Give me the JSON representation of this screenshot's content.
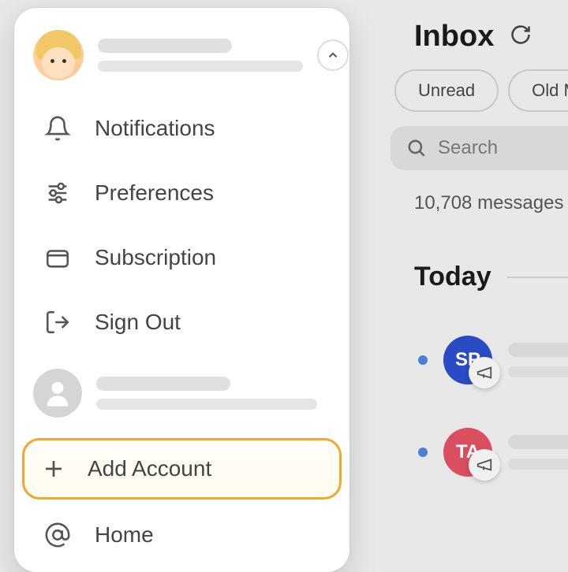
{
  "main": {
    "title": "Inbox",
    "filters": {
      "unread": "Unread",
      "old": "Old M"
    },
    "search_placeholder": "Search",
    "message_count": "10,708 messages",
    "section_label": "Today",
    "messages": [
      {
        "avatar_initials": "SP",
        "avatar_color": "blue"
      },
      {
        "avatar_initials": "TA",
        "avatar_color": "red"
      }
    ]
  },
  "menu": {
    "items": {
      "notifications": "Notifications",
      "preferences": "Preferences",
      "subscription": "Subscription",
      "signout": "Sign Out",
      "add_account": "Add Account",
      "home": "Home"
    }
  }
}
